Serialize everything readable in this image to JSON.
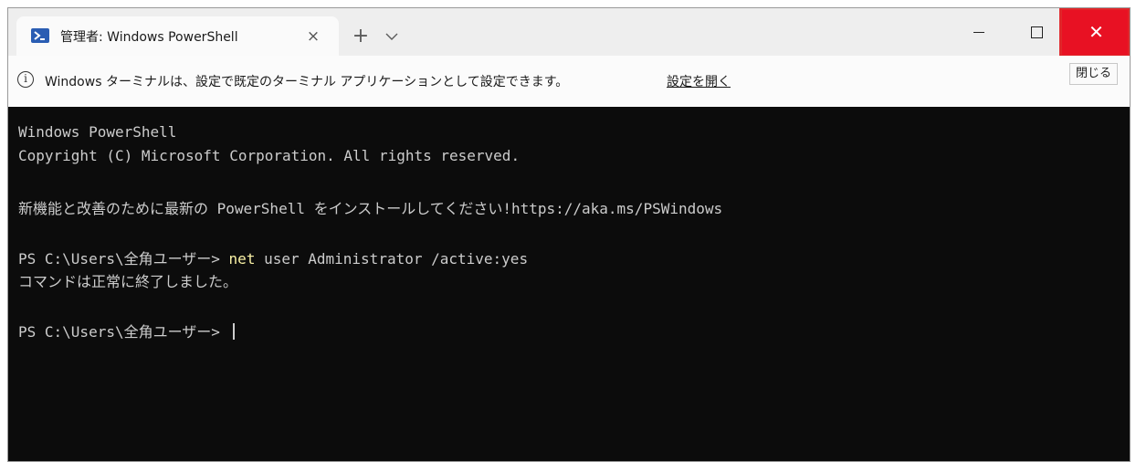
{
  "tab": {
    "title": "管理者: Windows PowerShell",
    "icon": "powershell-icon",
    "close_symbol": "×"
  },
  "toolbar": {
    "new_tab_symbol": "+",
    "dropdown_icon": "chevron-down-icon"
  },
  "window_controls": {
    "close_symbol": "✕",
    "close_tooltip": "閉じる",
    "close_color": "#e81123",
    "highlight_color": "#e0262a"
  },
  "infobar": {
    "icon_symbol": "i",
    "message": "Windows ターミナルは、設定で既定のターミナル アプリケーションとして設定できます。",
    "link": "設定を開く"
  },
  "terminal": {
    "line1": "Windows PowerShell",
    "line2": "Copyright (C) Microsoft Corporation. All rights reserved.",
    "line3": "新機能と改善のために最新の PowerShell をインストールしてください!https://aka.ms/PSWindows",
    "prompt1": "PS C:\\Users\\全角ユーザー> ",
    "command_keyword": "net",
    "command_args": " user Administrator /active:yes",
    "output1": "コマンドは正常に終了しました。",
    "prompt2": "PS C:\\Users\\全角ユーザー> ",
    "command_color": "#f9f1a5",
    "text_color": "#cccccc",
    "background": "#0c0c0c"
  }
}
